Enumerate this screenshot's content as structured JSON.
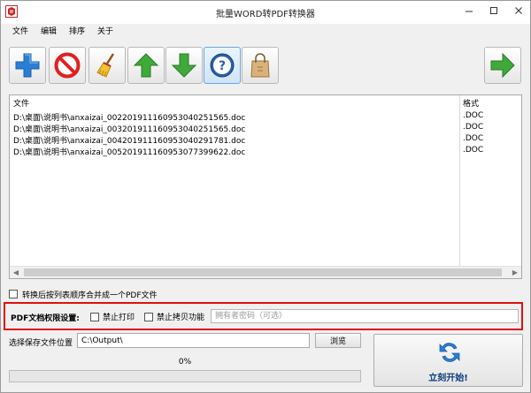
{
  "window": {
    "title": "批量WORD转PDF转换器"
  },
  "menu": [
    "文件",
    "编辑",
    "排序",
    "关于"
  ],
  "toolbar": {
    "buttons": [
      {
        "icon": "add-icon",
        "color": "#2a7fd4"
      },
      {
        "icon": "remove-icon",
        "color": "#e02020"
      },
      {
        "icon": "clear-broom-icon",
        "color": "#d9a21b"
      },
      {
        "icon": "move-up-icon",
        "color": "#3fa93a"
      },
      {
        "icon": "move-down-icon",
        "color": "#3fa93a"
      },
      {
        "icon": "help-icon",
        "color": "#2a5fa8"
      },
      {
        "icon": "shopping-bag-icon",
        "color": "#c79a5a"
      },
      {
        "icon": "next-arrow-icon",
        "color": "#3fa93a"
      }
    ]
  },
  "file_list": {
    "columns": [
      "文件",
      "格式"
    ],
    "rows": [
      {
        "file": "D:\\桌面\\说明书\\anxaizai_002201911160953040251565.doc",
        "format": ".DOC"
      },
      {
        "file": "D:\\桌面\\说明书\\anxaizai_003201911160953040251565.doc",
        "format": ".DOC"
      },
      {
        "file": "D:\\桌面\\说明书\\anxaizai_004201911160953040291781.doc",
        "format": ".DOC"
      },
      {
        "file": "D:\\桌面\\说明书\\anxaizai_005201911160953077399622.doc",
        "format": ".DOC"
      }
    ]
  },
  "merge_option": {
    "label": "转换后按列表顺序合并成一个PDF文件",
    "checked": false
  },
  "permissions": {
    "title": "PDF文档权限设置:",
    "forbid_print": {
      "label": "禁止打印",
      "checked": false
    },
    "forbid_copy": {
      "label": "禁止拷贝功能",
      "checked": false
    },
    "owner_password_placeholder": "拥有者密码（可选）"
  },
  "save": {
    "label": "选择保存文件位置",
    "path": "C:\\Output\\",
    "browse_label": "浏览"
  },
  "progress": {
    "text": "0%",
    "fraction": 0
  },
  "start": {
    "label": "立刻开始!"
  },
  "colors": {
    "highlight_border": "#e01010",
    "start_label": "#0b3b7a"
  }
}
